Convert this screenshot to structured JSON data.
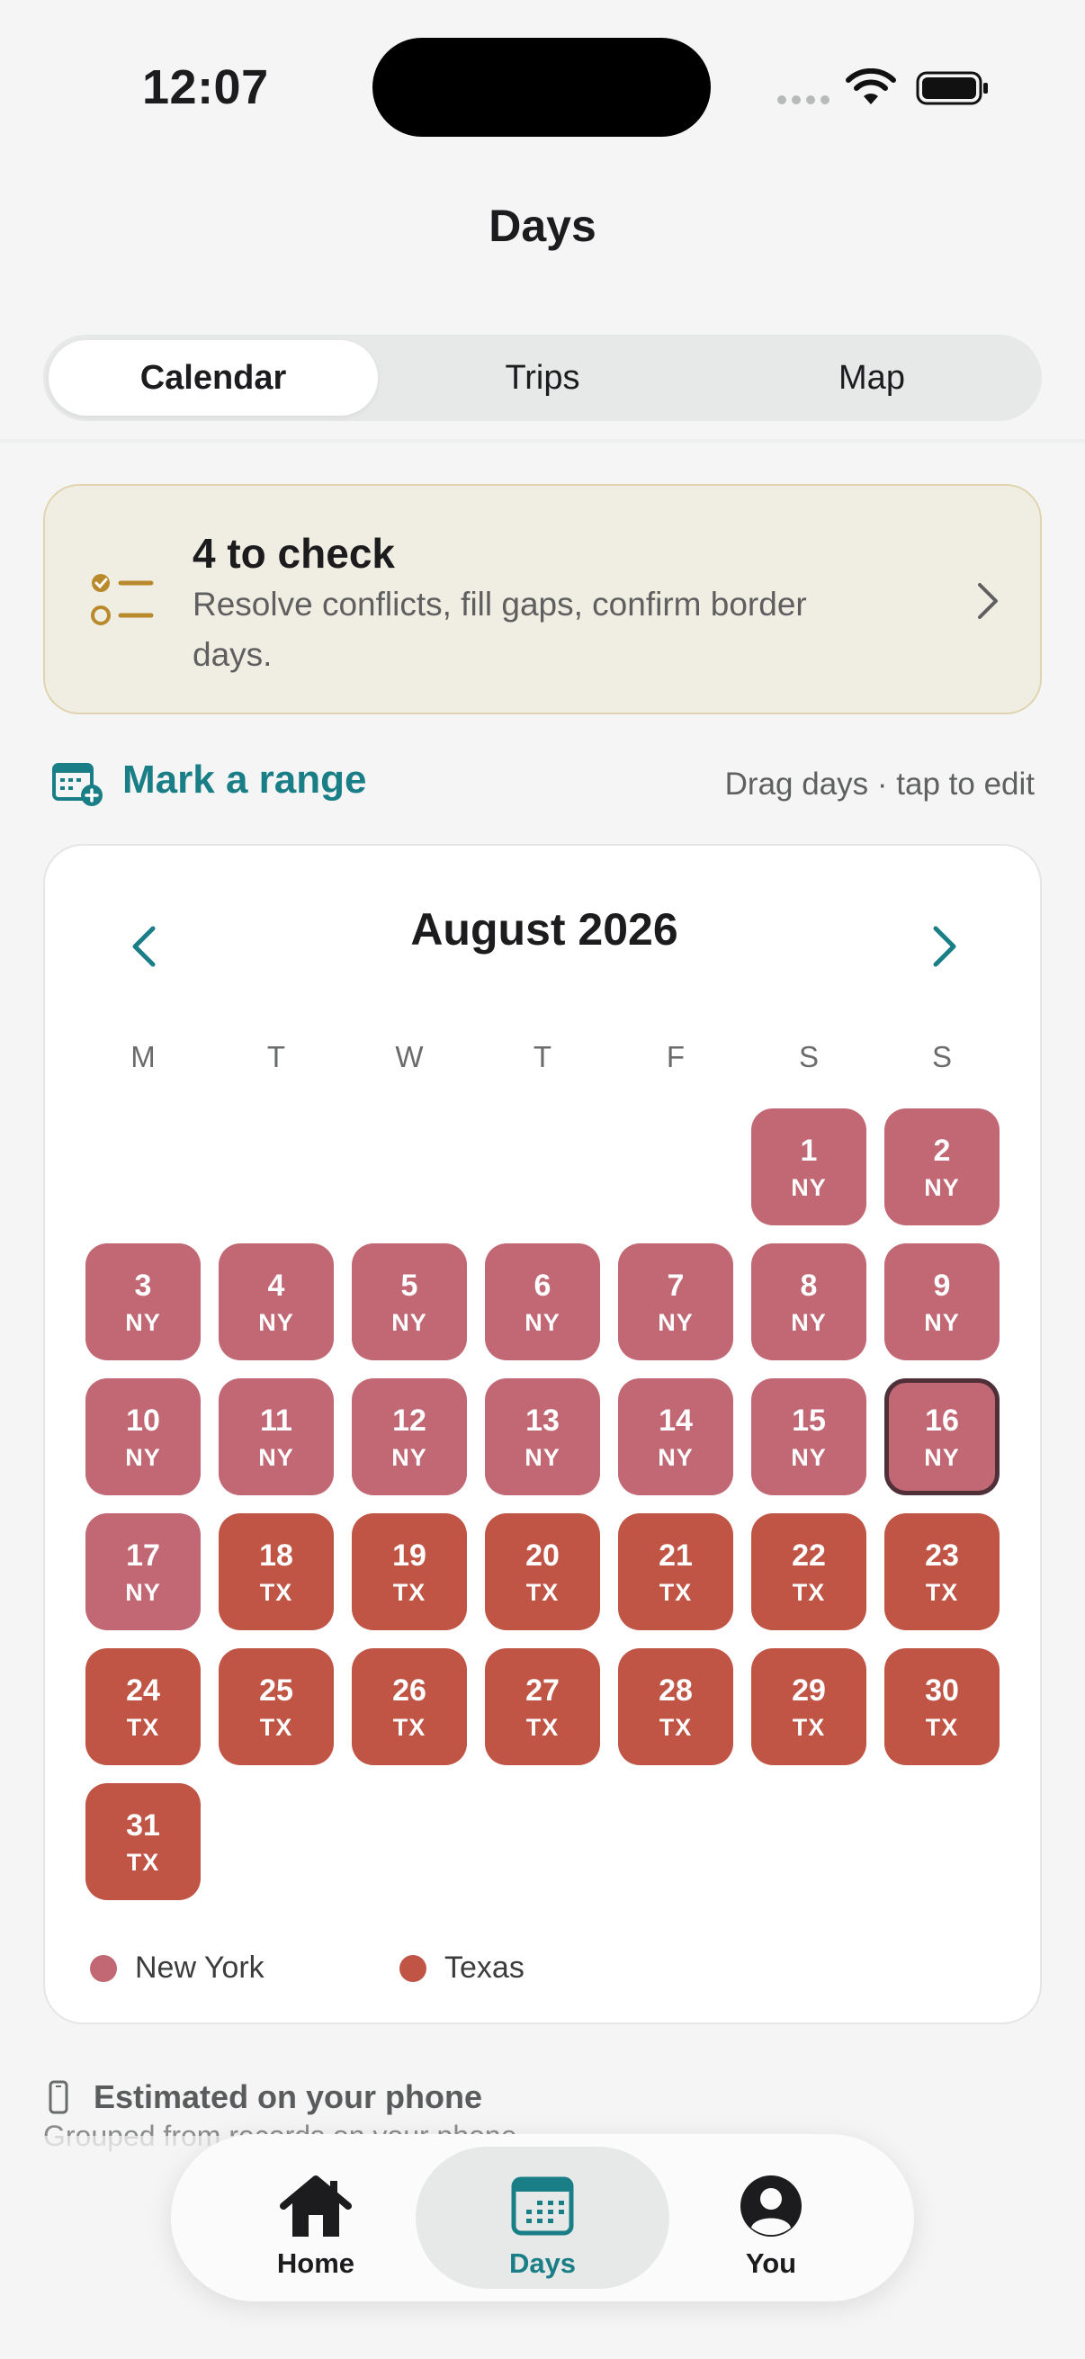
{
  "status_bar": {
    "time": "12:07"
  },
  "header": {
    "title": "Days"
  },
  "segments": [
    {
      "label": "Calendar",
      "active": true
    },
    {
      "label": "Trips",
      "active": false
    },
    {
      "label": "Map",
      "active": false
    }
  ],
  "check_card": {
    "title": "4 to check",
    "subtitle": "Resolve conflicts, fill gaps, confirm border days."
  },
  "mark_range": {
    "label": "Mark a range",
    "hint": "Drag days · tap to edit"
  },
  "calendar": {
    "month": "August 2026",
    "weekdays": [
      "M",
      "T",
      "W",
      "T",
      "F",
      "S",
      "S"
    ],
    "first_weekday_index": 5,
    "selected_day": 16,
    "days": [
      {
        "d": "1",
        "s": "NY"
      },
      {
        "d": "2",
        "s": "NY"
      },
      {
        "d": "3",
        "s": "NY"
      },
      {
        "d": "4",
        "s": "NY"
      },
      {
        "d": "5",
        "s": "NY"
      },
      {
        "d": "6",
        "s": "NY"
      },
      {
        "d": "7",
        "s": "NY"
      },
      {
        "d": "8",
        "s": "NY"
      },
      {
        "d": "9",
        "s": "NY"
      },
      {
        "d": "10",
        "s": "NY"
      },
      {
        "d": "11",
        "s": "NY"
      },
      {
        "d": "12",
        "s": "NY"
      },
      {
        "d": "13",
        "s": "NY"
      },
      {
        "d": "14",
        "s": "NY"
      },
      {
        "d": "15",
        "s": "NY"
      },
      {
        "d": "16",
        "s": "NY"
      },
      {
        "d": "17",
        "s": "NY"
      },
      {
        "d": "18",
        "s": "TX"
      },
      {
        "d": "19",
        "s": "TX"
      },
      {
        "d": "20",
        "s": "TX"
      },
      {
        "d": "21",
        "s": "TX"
      },
      {
        "d": "22",
        "s": "TX"
      },
      {
        "d": "23",
        "s": "TX"
      },
      {
        "d": "24",
        "s": "TX"
      },
      {
        "d": "25",
        "s": "TX"
      },
      {
        "d": "26",
        "s": "TX"
      },
      {
        "d": "27",
        "s": "TX"
      },
      {
        "d": "28",
        "s": "TX"
      },
      {
        "d": "29",
        "s": "TX"
      },
      {
        "d": "30",
        "s": "TX"
      },
      {
        "d": "31",
        "s": "TX"
      }
    ],
    "legend": [
      {
        "label": "New York",
        "color": "#c26875"
      },
      {
        "label": "Texas",
        "color": "#c05546"
      }
    ]
  },
  "estimate": {
    "title": "Estimated on your phone",
    "subtitle": "Grouped from records on your phone"
  },
  "tabbar": [
    {
      "label": "Home",
      "icon": "house-icon",
      "active": false
    },
    {
      "label": "Days",
      "icon": "calendar-icon",
      "active": true
    },
    {
      "label": "You",
      "icon": "person-icon",
      "active": false
    }
  ],
  "colors": {
    "accent": "#1a7e87",
    "ny": "#c26875",
    "tx": "#c05546",
    "warning": "#b98a2b"
  }
}
